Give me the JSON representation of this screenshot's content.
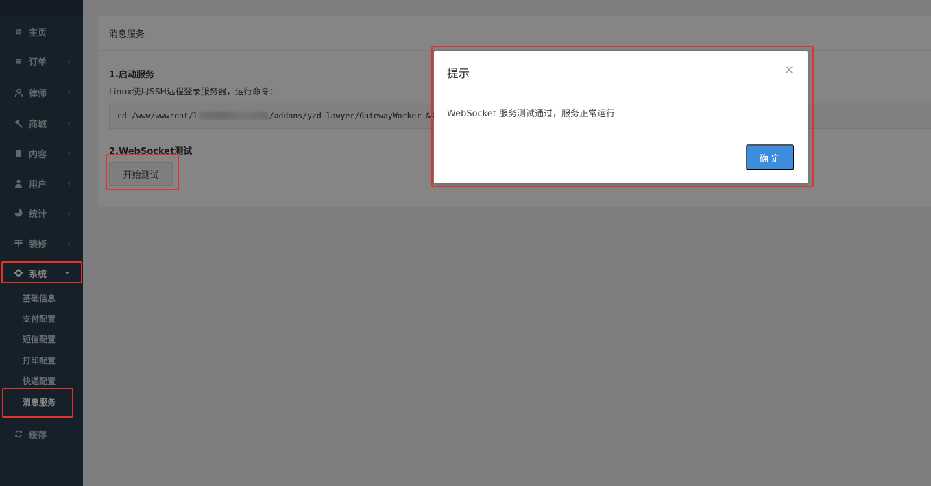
{
  "sidebar": {
    "items": [
      {
        "label": "主页",
        "icon": "copy-icon",
        "has_chevron": false
      },
      {
        "label": "订单",
        "icon": "bars-icon",
        "has_chevron": true
      },
      {
        "label": "律师",
        "icon": "user-group-icon",
        "has_chevron": true
      },
      {
        "label": "商城",
        "icon": "gavel-icon",
        "has_chevron": true
      },
      {
        "label": "内容",
        "icon": "book-icon",
        "has_chevron": true
      },
      {
        "label": "用户",
        "icon": "user-icon",
        "has_chevron": true
      },
      {
        "label": "统计",
        "icon": "pie-chart-icon",
        "has_chevron": true
      },
      {
        "label": "装修",
        "icon": "brush-icon",
        "has_chevron": true
      },
      {
        "label": "系统",
        "icon": "gear-icon",
        "has_chevron": true,
        "expanded": true
      },
      {
        "label": "缓存",
        "icon": "refresh-icon",
        "has_chevron": false
      }
    ],
    "sub_items": [
      {
        "label": "基础信息"
      },
      {
        "label": "支付配置"
      },
      {
        "label": "短信配置"
      },
      {
        "label": "打印配置"
      },
      {
        "label": "快递配置"
      },
      {
        "label": "消息服务",
        "current": true
      }
    ],
    "chevron_collapsed": "‹",
    "chevron_expanded": "⌄"
  },
  "main": {
    "panel_title": "消息服务",
    "section1_title": "1.启动服务",
    "section1_desc": "Linux使用SSH远程登录服务器，运行命令：",
    "command_prefix": "cd /www/wwwroot/l",
    "command_suffix": "/addons/yzd_lawyer/GatewayWorker &&",
    "section2_title": "2.WebSocket测试",
    "test_button": "开始测试"
  },
  "dialog": {
    "title": "提示",
    "close": "×",
    "message": "WebSocket 服务测试通过，服务正常运行",
    "ok_button": "确 定"
  },
  "colors": {
    "sidebar_bg": "#2b3e50",
    "primary": "#3c8dde",
    "highlight": "#e3322b"
  }
}
